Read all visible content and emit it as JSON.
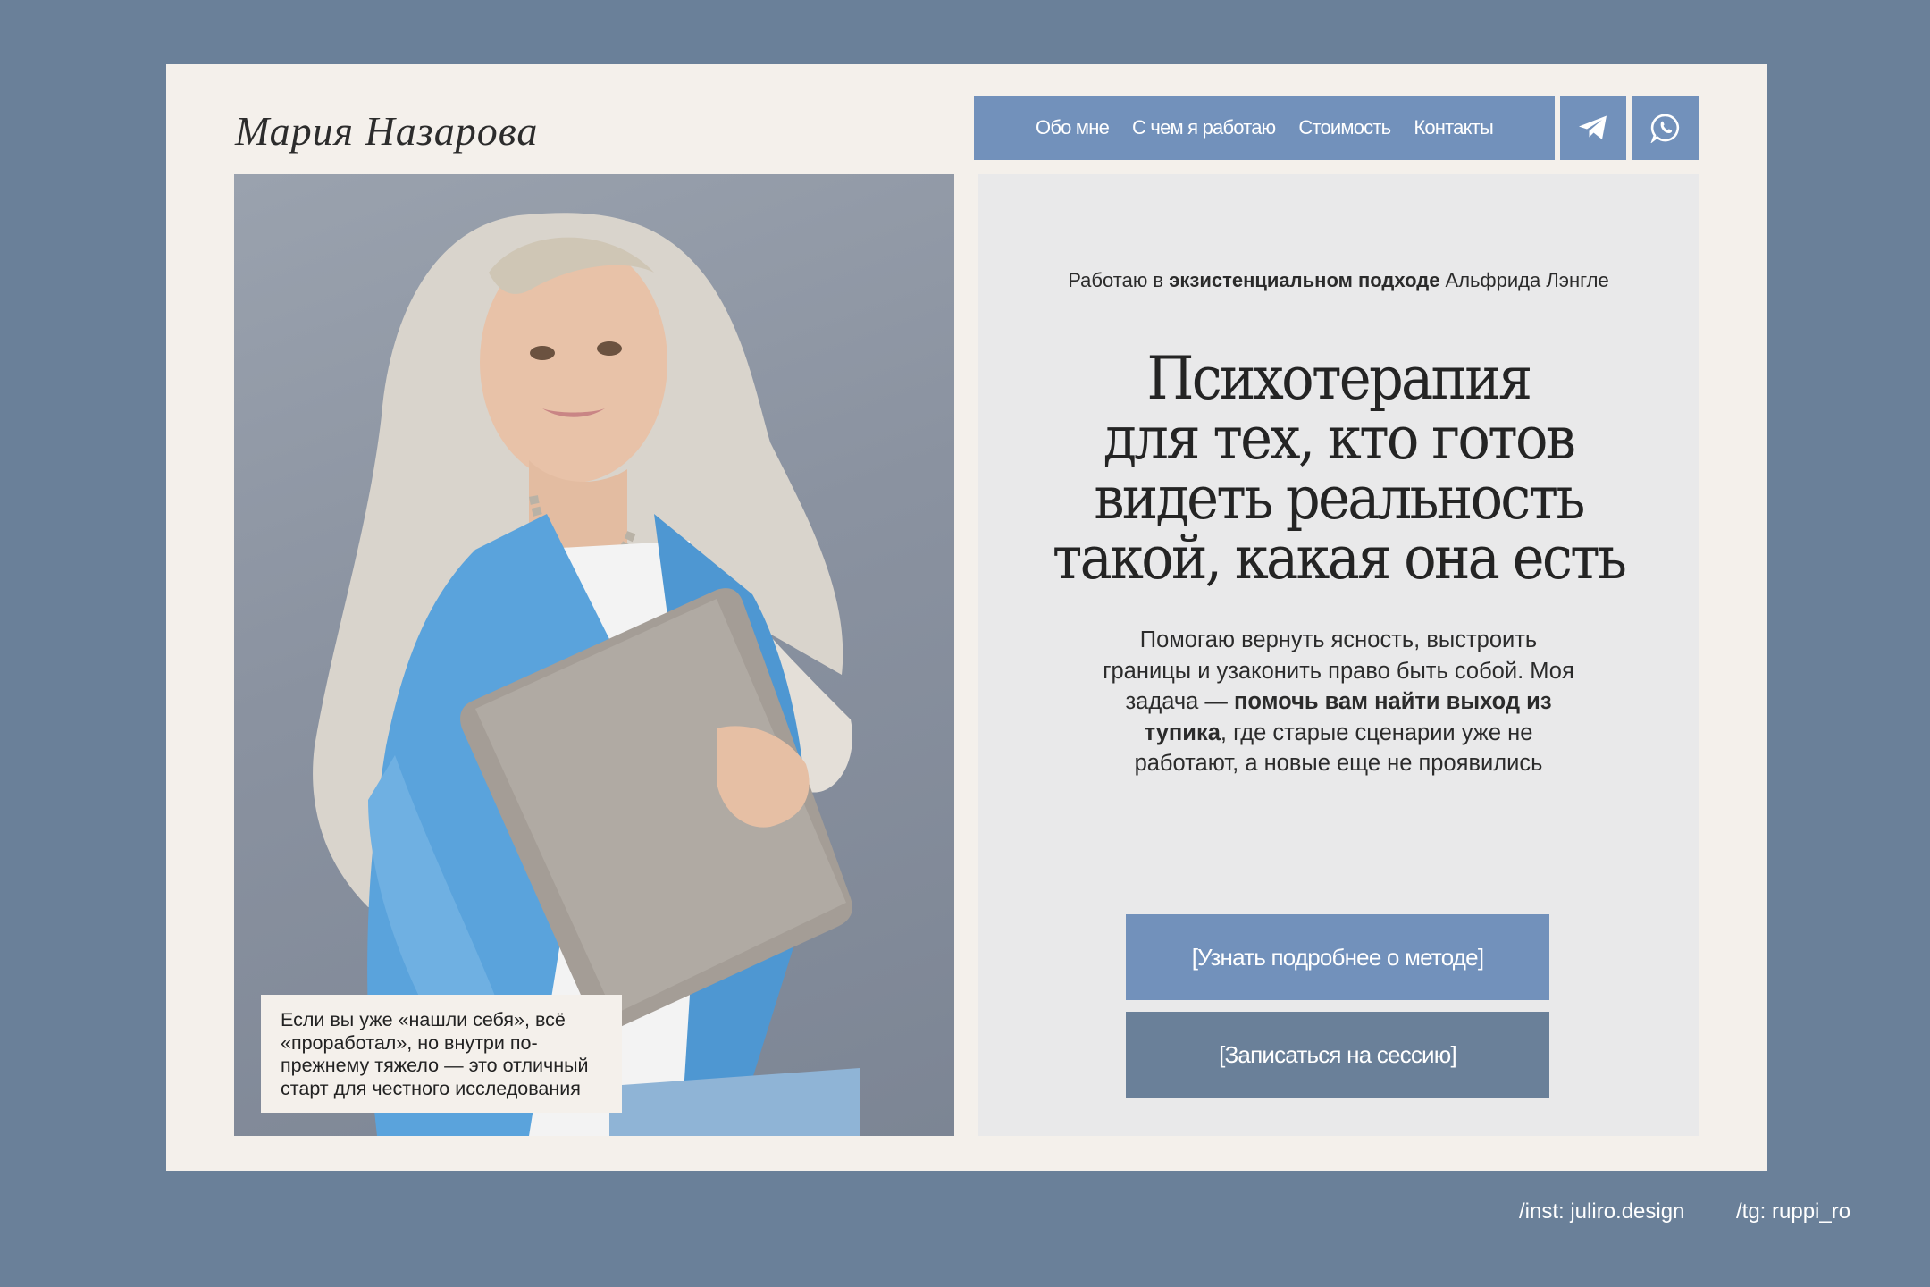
{
  "header": {
    "logo": "Мария Назарова",
    "nav": [
      "Обо мне",
      "С чем я работаю",
      "Стоимость",
      "Контакты"
    ],
    "social": [
      {
        "icon": "telegram-icon"
      },
      {
        "icon": "whatsapp-icon"
      }
    ]
  },
  "photo": {
    "caption": "Если вы уже «нашли себя», всё «проработал», но внутри по-прежнему тяжело — это отличный старт для честного исследования"
  },
  "hero": {
    "approach_prefix": "Работаю в ",
    "approach_bold": "экзистенциальном подходе",
    "approach_suffix": " Альфрида Лэнгле",
    "headline_lines": [
      "Психотерапия",
      "для тех, кто готов",
      "видеть реальность",
      "такой, какая она есть"
    ],
    "desc_part1": "Помогаю вернуть ясность, выстроить границы и узаконить право быть собой. Моя задача — ",
    "desc_bold": "помочь вам найти выход из тупика",
    "desc_part2": ", где старые сценарии уже не работают, а новые еще не проявились",
    "cta_primary": "[Узнать подробнее о методе]",
    "cta_secondary": "[Записаться на сессию]"
  },
  "footer": {
    "inst": "/inst: juliro.design",
    "tg": "/tg: ruppi_ro"
  },
  "colors": {
    "background": "#6a8099",
    "frame": "#f4f0eb",
    "accent": "#7291bb",
    "panel": "#e9e9ea"
  }
}
